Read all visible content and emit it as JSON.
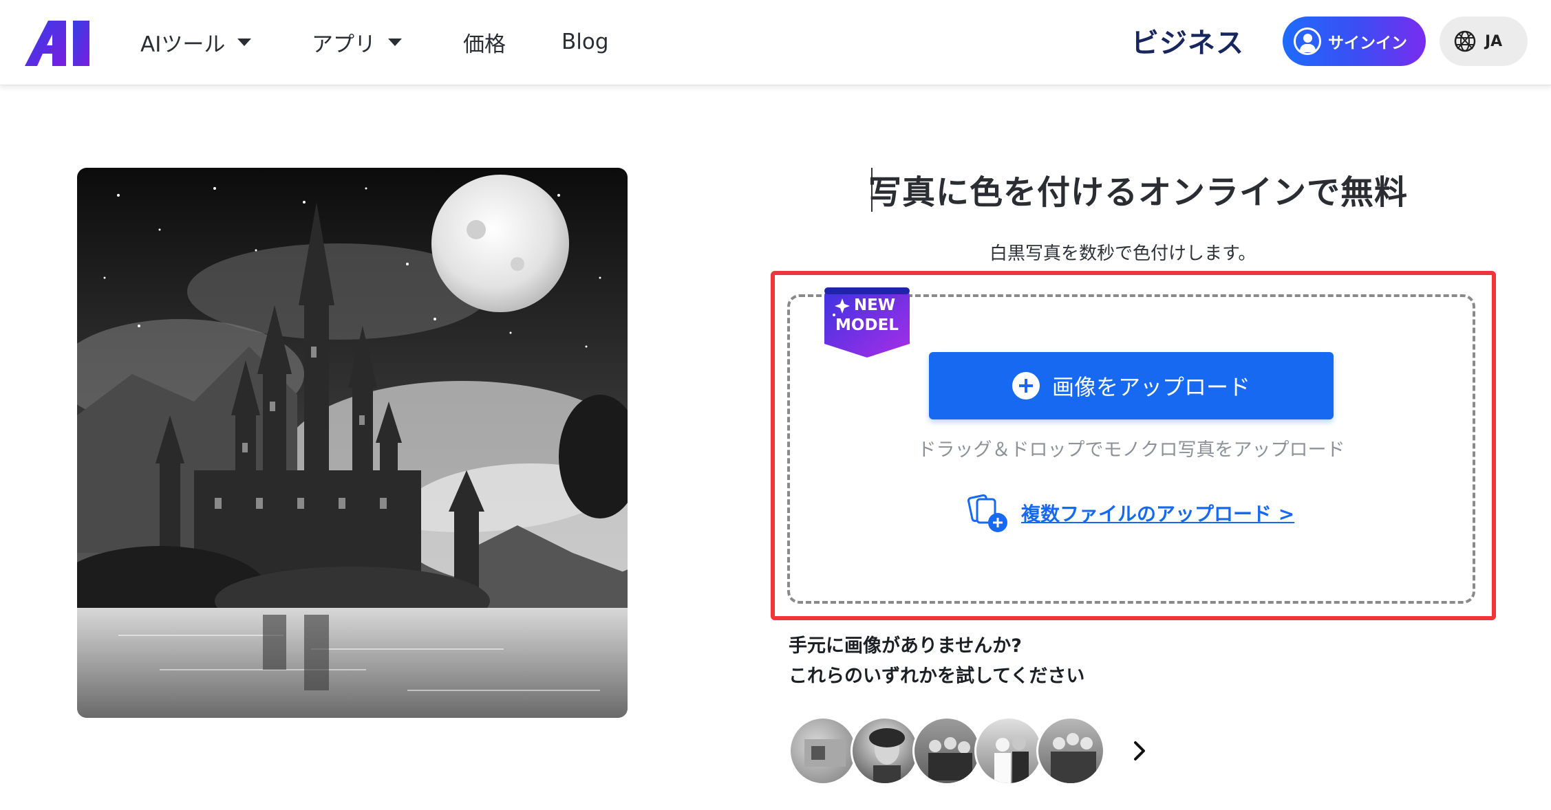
{
  "header": {
    "logo_text": "AI",
    "nav": [
      {
        "label": "AIツール",
        "has_dropdown": true
      },
      {
        "label": "アプリ",
        "has_dropdown": true
      },
      {
        "label": "価格",
        "has_dropdown": false
      },
      {
        "label": "Blog",
        "has_dropdown": false
      }
    ],
    "business_label": "ビジネス",
    "signin_label": "サインイン",
    "lang_label": "JA"
  },
  "hero": {
    "image_alt": "モノクロの城と満月の風景画",
    "title": "写真に色を付けるオンラインで無料",
    "subtitle": "白黒写真を数秒で色付けします。"
  },
  "upload": {
    "badge_line1": "NEW",
    "badge_line2": "MODEL",
    "button_label": "画像をアップロード",
    "drag_hint": "ドラッグ＆ドロップでモノクロ写真をアップロード",
    "multi_label": "複数ファイルのアップロード >"
  },
  "samples": {
    "prompt_line1": "手元に画像がありませんか?",
    "prompt_line2": "これらのいずれかを試してください",
    "items": [
      "sample-1",
      "sample-2",
      "sample-3",
      "sample-4",
      "sample-5"
    ]
  },
  "colors": {
    "accent": "#1769f2",
    "highlight_box": "#f0353d",
    "badge_gradient_start": "#3c33e0",
    "badge_gradient_end": "#a82ee8"
  }
}
